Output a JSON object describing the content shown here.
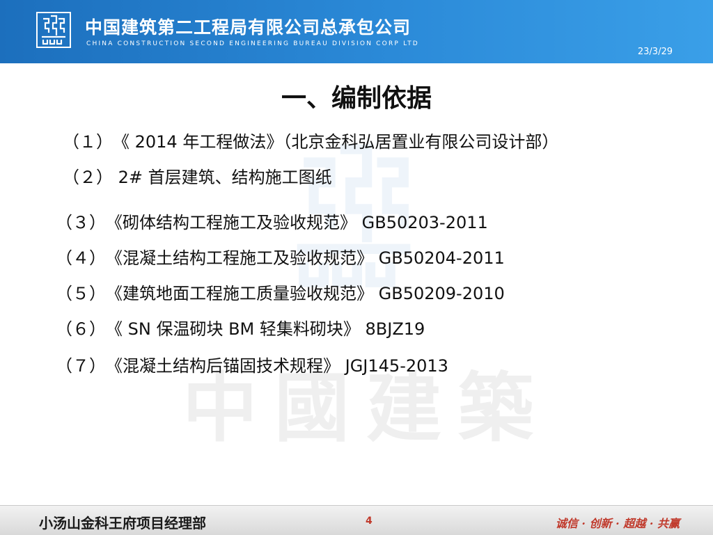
{
  "header": {
    "company_cn": "中国建筑第二工程局有限公司总承包公司",
    "company_en": "CHINA CONSTRUCTION SECOND ENGINEERING BUREAU DIVISION CORP LTD",
    "date": "23/3/29",
    "logo_icon": "cscec-logo-icon",
    "bg_color": "#2b8ad8"
  },
  "watermark": {
    "text": "中國建築",
    "icon": "cscec-watermark-icon"
  },
  "title": "一、编制依据",
  "items": [
    {
      "num": "（１）",
      "text": "《 2014 年工程做法》（北京金科弘居置业有限公司设计部）"
    },
    {
      "num": "（２）",
      "text": "  2# 首层建筑、结构施工图纸"
    },
    {
      "num": "（３）",
      "text": "《砌体结构工程施工及验收规范》 GB50203-2011"
    },
    {
      "num": "（４）",
      "text": "《混凝土结构工程施工及验收规范》 GB50204-2011"
    },
    {
      "num": "（５）",
      "text": "《建筑地面工程施工质量验收规范》 GB50209-2010"
    },
    {
      "num": "（６）",
      "text": "《 SN 保温砌块 BM 轻集料砌块》 8BJZ19"
    },
    {
      "num": "（７）",
      "text": "《混凝土结构后锚固技术规程》 JGJ145-2013"
    }
  ],
  "footer": {
    "project": "小汤山金科王府项目经理部",
    "page": "4",
    "motto": "诚信 · 创新 · 超越 · 共赢",
    "accent_color": "#c0392b"
  }
}
